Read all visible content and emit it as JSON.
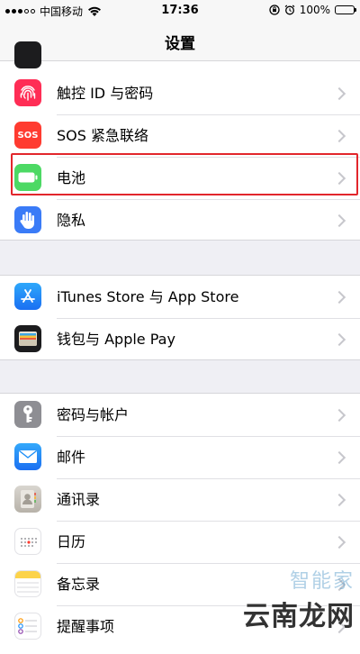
{
  "status_bar": {
    "carrier": "中国移动",
    "time": "17:36",
    "battery_percent": "100%",
    "icons": [
      "signal-icon",
      "wifi-icon",
      "rotation-lock-icon",
      "alarm-icon",
      "battery-icon"
    ]
  },
  "nav": {
    "title": "设置"
  },
  "group1": {
    "items": [
      {
        "label": "触控 ID 与密码",
        "icon": "fingerprint-icon",
        "color": "#ff2d55"
      },
      {
        "label": "SOS 紧急联络",
        "icon": "sos-icon",
        "color": "#ff3b30",
        "icon_text": "SOS"
      },
      {
        "label": "电池",
        "icon": "battery-icon",
        "color": "#4cd964"
      },
      {
        "label": "隐私",
        "icon": "hand-icon",
        "color": "#3a7bf7"
      }
    ]
  },
  "group2": {
    "items": [
      {
        "label": "iTunes Store 与 App Store",
        "icon": "app-store-icon",
        "color": "#1e8ff7"
      },
      {
        "label": "钱包与 Apple Pay",
        "icon": "wallet-icon",
        "color": "#1c1c1e"
      }
    ]
  },
  "group3": {
    "items": [
      {
        "label": "密码与帐户",
        "icon": "key-icon",
        "color": "#8e8e93"
      },
      {
        "label": "邮件",
        "icon": "mail-icon",
        "color": "#1e8ff7"
      },
      {
        "label": "通讯录",
        "icon": "contacts-icon",
        "color": "#c8c4bd"
      },
      {
        "label": "日历",
        "icon": "calendar-icon",
        "color": "#ffffff"
      },
      {
        "label": "备忘录",
        "icon": "notes-icon",
        "color": "#ffffff"
      },
      {
        "label": "提醒事项",
        "icon": "reminders-icon",
        "color": "#ffffff"
      }
    ]
  },
  "watermark": {
    "top": "智能家",
    "bottom": "云南龙网"
  },
  "highlight_color": "#e2262c"
}
